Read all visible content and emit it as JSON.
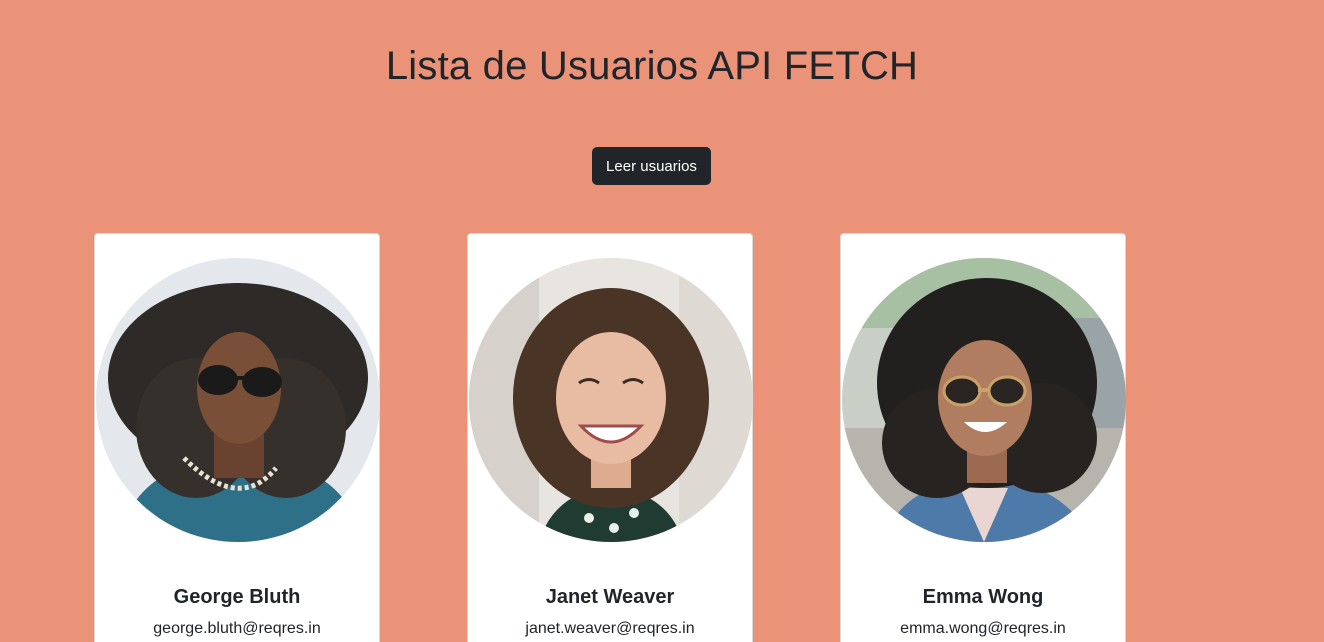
{
  "page": {
    "title": "Lista de Usuarios API FETCH",
    "button_label": "Leer usuarios",
    "background_color": "#ea9378"
  },
  "users": [
    {
      "name": "George Bluth",
      "email": "george.bluth@reqres.in",
      "avatar": "avatar-photo-man-curly-hair-sunglasses"
    },
    {
      "name": "Janet Weaver",
      "email": "janet.weaver@reqres.in",
      "avatar": "avatar-photo-woman-smiling"
    },
    {
      "name": "Emma Wong",
      "email": "emma.wong@reqres.in",
      "avatar": "avatar-photo-woman-curly-hair-sunglasses"
    }
  ]
}
